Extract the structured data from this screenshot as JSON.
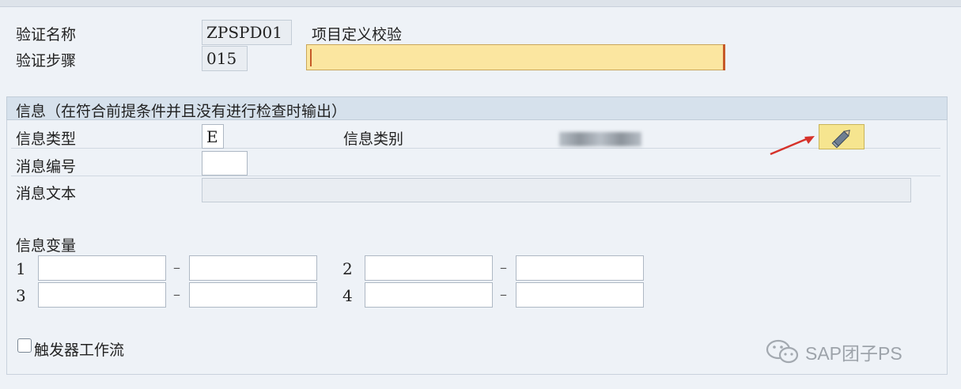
{
  "header": {
    "validation_name_label": "验证名称",
    "validation_name_value": "ZPSPD01",
    "validation_name_desc": "项目定义校验",
    "validation_step_label": "验证步骤",
    "validation_step_value": "015",
    "step_description_value": ""
  },
  "info_group": {
    "title": "信息（在符合前提条件并且没有进行检查时输出）",
    "message_type_label": "信息类型",
    "message_type_value": "E",
    "message_class_label": "信息类别",
    "message_number_label": "消息编号",
    "message_number_value": "",
    "message_text_label": "消息文本",
    "message_text_value": "",
    "edit_icon": "pencil-icon"
  },
  "variables": {
    "label": "信息变量",
    "rows": [
      {
        "num": "1",
        "from": "",
        "to": ""
      },
      {
        "num": "2",
        "from": "",
        "to": ""
      },
      {
        "num": "3",
        "from": "",
        "to": ""
      },
      {
        "num": "4",
        "from": "",
        "to": ""
      }
    ],
    "separator": "–"
  },
  "workflow": {
    "label": "触发器工作流",
    "checked": false
  },
  "watermark": {
    "text": "SAP团子PS",
    "icon": "wechat-icon"
  },
  "colors": {
    "required_field": "#fbe6a0",
    "arrow": "#d6322a",
    "edit_button": "#f6e58f"
  }
}
